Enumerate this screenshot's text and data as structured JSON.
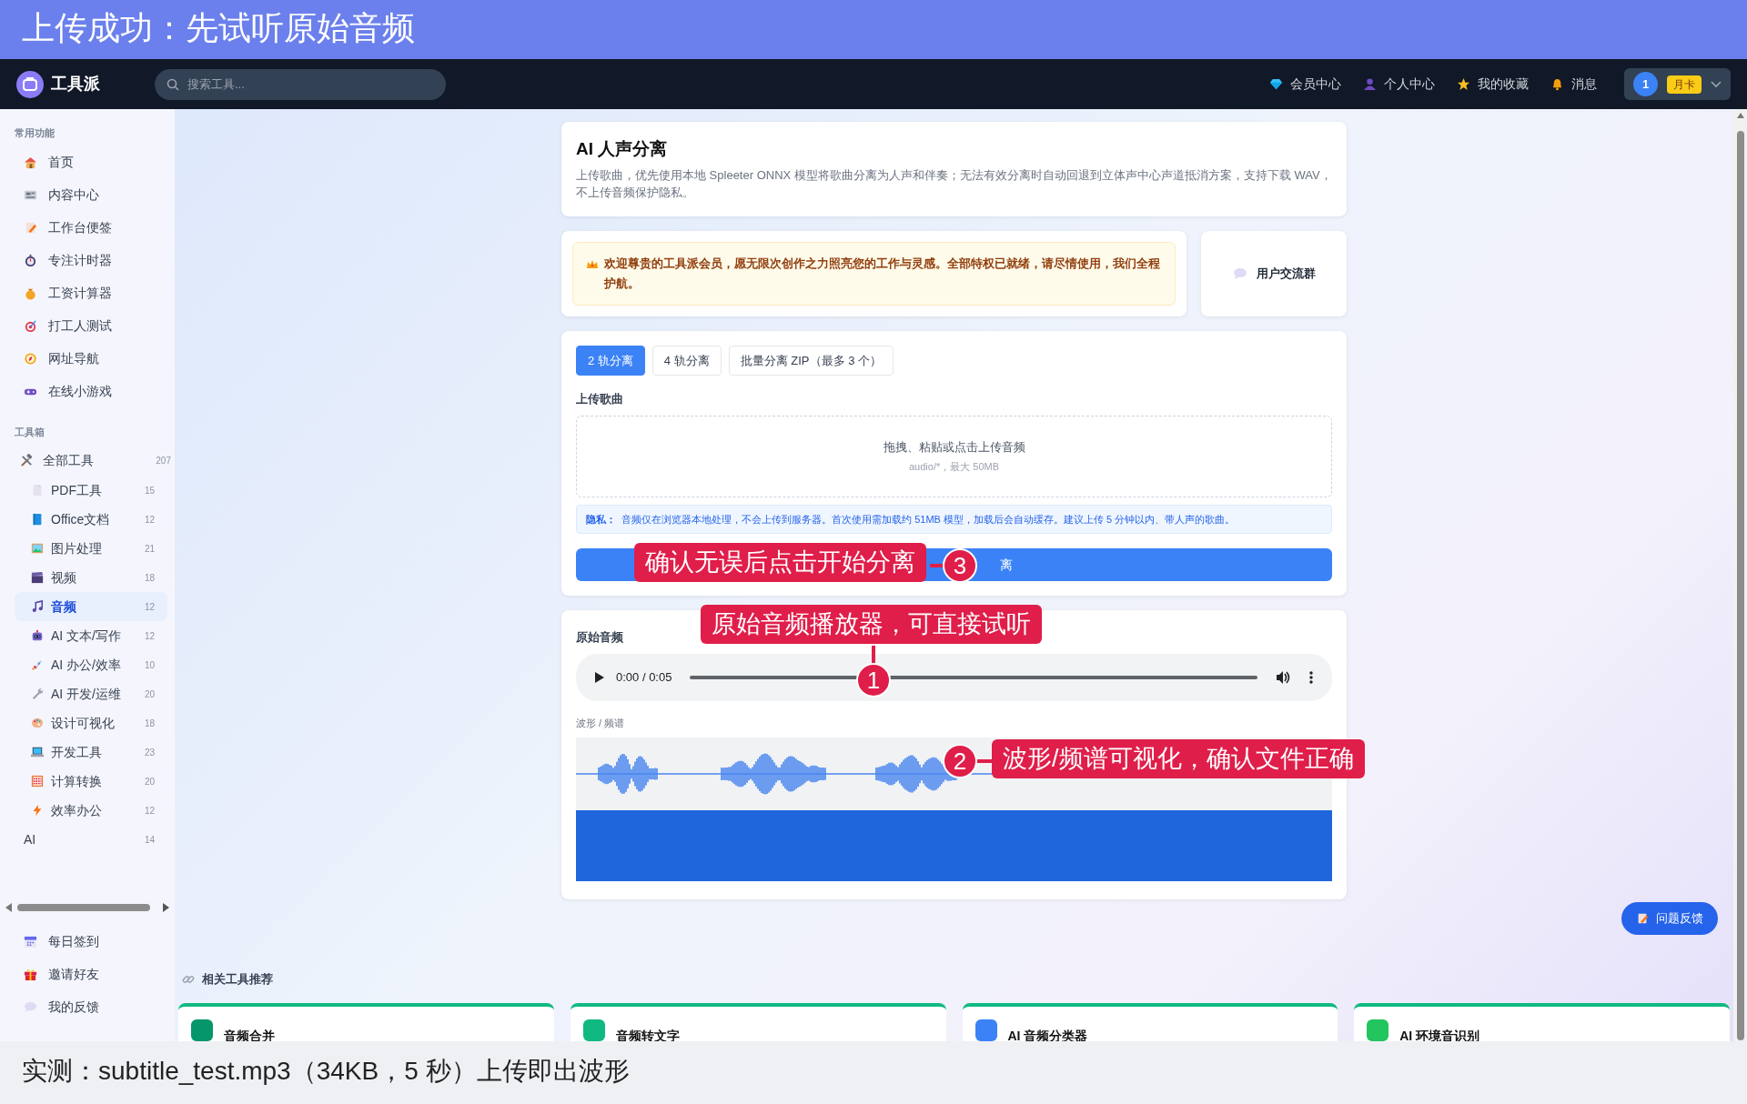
{
  "caption_top": "上传成功：先试听原始音频",
  "app": {
    "name": "工具派"
  },
  "search": {
    "placeholder": "搜索工具..."
  },
  "nav_links": [
    {
      "label": "会员中心",
      "kind": "diamond"
    },
    {
      "label": "个人中心",
      "kind": "person"
    },
    {
      "label": "我的收藏",
      "kind": "star"
    },
    {
      "label": "消息",
      "kind": "bell"
    }
  ],
  "user": {
    "avatar": "1",
    "badge": "月卡"
  },
  "sidebar": {
    "sections": [
      {
        "title": "常用功能",
        "items": [
          {
            "label": "首页",
            "kind": "house"
          },
          {
            "label": "内容中心",
            "kind": "news"
          },
          {
            "label": "工作台便签",
            "kind": "memo"
          },
          {
            "label": "专注计时器",
            "kind": "stopwatch"
          },
          {
            "label": "工资计算器",
            "kind": "moneybag"
          },
          {
            "label": "打工人测试",
            "kind": "target"
          },
          {
            "label": "网址导航",
            "kind": "compass"
          },
          {
            "label": "在线小游戏",
            "kind": "gamepad"
          }
        ]
      },
      {
        "title": "工具箱",
        "items": [
          {
            "label": "全部工具",
            "kind": "tools",
            "count": "207",
            "children": [
              {
                "label": "PDF工具",
                "kind": "page",
                "count": "15",
                "selected": false
              },
              {
                "label": "Office文档",
                "kind": "book",
                "count": "12",
                "selected": false
              },
              {
                "label": "图片处理",
                "kind": "image",
                "count": "21",
                "selected": false
              },
              {
                "label": "视频",
                "kind": "clapper",
                "count": "18",
                "selected": false
              },
              {
                "label": "音频",
                "kind": "music",
                "count": "12",
                "selected": true
              },
              {
                "label": "AI 文本/写作",
                "kind": "robot",
                "count": "12",
                "selected": false
              },
              {
                "label": "AI 办公/效率",
                "kind": "rocket",
                "count": "10",
                "selected": false
              },
              {
                "label": "AI 开发/运维",
                "kind": "wrench",
                "count": "20",
                "selected": false
              },
              {
                "label": "设计可视化",
                "kind": "palette",
                "count": "18",
                "selected": false
              },
              {
                "label": "开发工具",
                "kind": "laptop",
                "count": "23",
                "selected": false
              },
              {
                "label": "计算转换",
                "kind": "abacus",
                "count": "20",
                "selected": false
              },
              {
                "label": "效率办公",
                "kind": "bolt",
                "count": "12",
                "selected": false
              },
              {
                "label": "AI",
                "kind": "none",
                "count": "14",
                "selected": false
              }
            ]
          }
        ]
      }
    ],
    "bottom_items": [
      {
        "label": "每日签到",
        "kind": "calendar"
      },
      {
        "label": "邀请好友",
        "kind": "gift"
      },
      {
        "label": "我的反馈",
        "kind": "chat"
      }
    ]
  },
  "tool": {
    "title": "AI 人声分离",
    "description": "上传歌曲，优先使用本地 Spleeter ONNX 模型将歌曲分离为人声和伴奏；无法有效分离时自动回退到立体声中心声道抵消方案，支持下载 WAV，不上传音频保护隐私。"
  },
  "welcome": {
    "text": "欢迎尊贵的工具派会员，愿无限次创作之力照亮您的工作与灵感。全部特权已就绪，请尽情使用，我们全程护航。"
  },
  "group_button": "用户交流群",
  "tabs": [
    {
      "label": "2 轨分离",
      "selected": true
    },
    {
      "label": "4 轨分离",
      "selected": false
    },
    {
      "label": "批量分离 ZIP（最多 3 个）",
      "selected": false
    }
  ],
  "upload": {
    "label": "上传歌曲",
    "prompt": "拖拽、粘贴或点击上传音频",
    "hint": "audio/*，最大 50MB"
  },
  "privacy": "**隐私：**  音频仅在浏览器本地处理，不会上传到服务器。首次使用需加载约 51MB 模型，加载后会自动缓存。建议上传 5 分钟以内、带人声的歌曲。",
  "start_button": "离",
  "audio": {
    "label": "原始音频",
    "time": "0:00 / 0:05",
    "viz_label": "波形 / 频谱"
  },
  "annotations": [
    {
      "number": "1",
      "text": "原始音频播放器，可直接试听"
    },
    {
      "number": "2",
      "text": "波形/频谱可视化，确认文件正确"
    },
    {
      "number": "3",
      "text": "确认无误后点击开始分离"
    }
  ],
  "related": {
    "title": "相关工具推荐",
    "cards": [
      {
        "name": "音频合并",
        "color": "#059669"
      },
      {
        "name": "音频转文字",
        "color": "#10b981"
      },
      {
        "name": "AI 音频分类器",
        "color": "#3b82f6"
      },
      {
        "name": "AI 环境音识别",
        "color": "#22c55e"
      }
    ]
  },
  "feedback_button": "问题反馈",
  "caption_bottom": "实测：subtitle_test.mp3（34KB，5 秒）上传即出波形"
}
